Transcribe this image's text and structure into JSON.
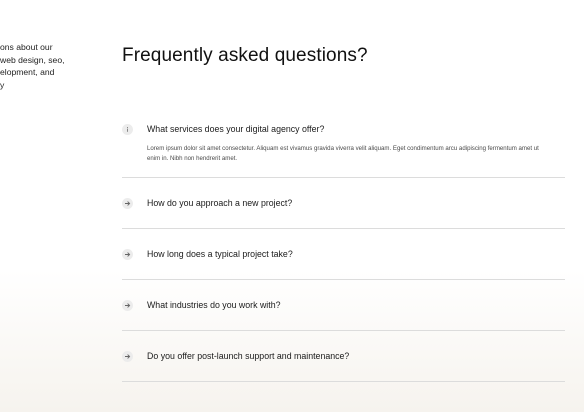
{
  "intro": {
    "text": "ons about our\nweb design, seo,\nelopment, and\ny"
  },
  "faq": {
    "title": "Frequently asked questions?",
    "items": [
      {
        "question": "What services does your digital agency offer?",
        "answer": "Lorem ipsum dolor sit amet consectetur. Aliquam est vivamus gravida viverra velit aliquam. Eget condimentum arcu adipiscing fermentum amet ut enim in. Nibh non hendrerit amet.",
        "expanded": true,
        "icon": "info-icon"
      },
      {
        "question": "How do you approach a new project?",
        "expanded": false,
        "icon": "arrow-right-icon"
      },
      {
        "question": "How long does a typical project take?",
        "expanded": false,
        "icon": "arrow-right-icon"
      },
      {
        "question": "What industries do you work with?",
        "expanded": false,
        "icon": "arrow-right-icon"
      },
      {
        "question": "Do you offer post-launch support and maintenance?",
        "expanded": false,
        "icon": "arrow-right-icon"
      }
    ]
  },
  "colors": {
    "text": "#1a1a1a",
    "muted_text": "#4a4a4a",
    "divider": "#dcdcdc",
    "icon_bg": "#ececec",
    "page_bottom": "#f6f3ee"
  }
}
